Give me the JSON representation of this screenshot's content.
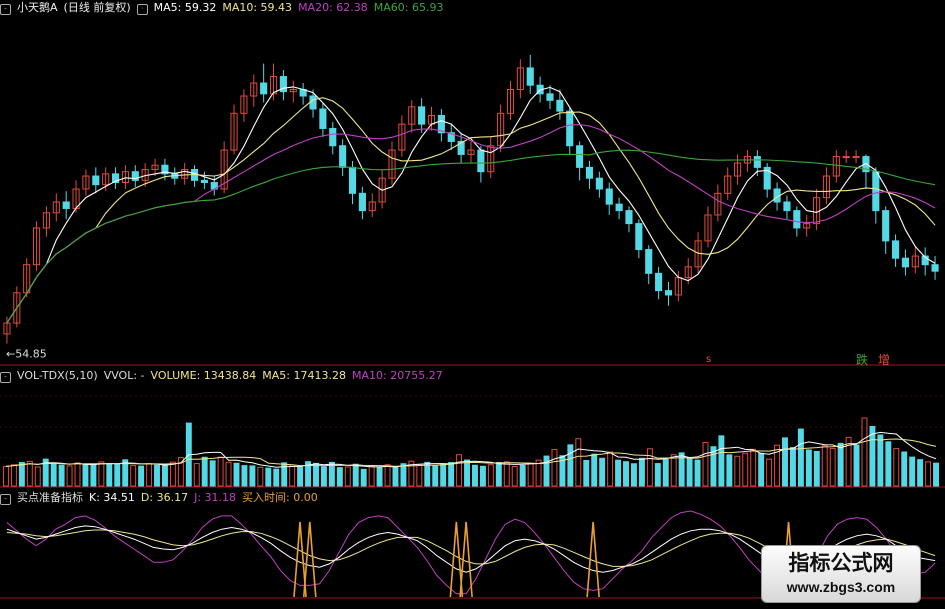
{
  "header_main": {
    "stock": "小天鹅A",
    "period": "(日线 前复权)",
    "ma5": "MA5: 59.32",
    "ma10": "MA10: 59.43",
    "ma20": "MA20: 62.38",
    "ma60": "MA60: 65.93"
  },
  "header_vol": {
    "name": "VOL-TDX(5,10)",
    "vvol": "VVOL: -",
    "volume": "VOLUME: 13438.84",
    "ma5": "MA5: 17413.28",
    "ma10": "MA10: 20755.27"
  },
  "header_kdj": {
    "name": "买点准备指标",
    "k": "K: 34.51",
    "d": "D: 36.17",
    "j": "J: 31.18",
    "buy": "买入时间: 0.00"
  },
  "annotations": {
    "low_price": "54.85",
    "marker_up": "增",
    "marker_down": "跌",
    "marker_left": "s"
  },
  "watermark": {
    "title": "指标公式网",
    "url": "www.zbgs3.com"
  },
  "colors": {
    "up": "#e24b3b",
    "down": "#54d8e6",
    "ma5": "#ffffff",
    "ma10": "#f0e68c",
    "ma20": "#c040c0",
    "ma60": "#3aa63a",
    "vol_ma5": "#ffffff",
    "vol_ma10": "#f0e68c",
    "kdj_k": "#ffffff",
    "kdj_d": "#f0e68c",
    "kdj_j": "#c040c0",
    "buy_spike": "#e8a030"
  },
  "chart_data": {
    "type": "candlestick",
    "price_ylim": [
      54,
      70
    ],
    "candles": [
      [
        55.3,
        55.8,
        54.85,
        56.1
      ],
      [
        55.8,
        57.2,
        55.6,
        57.5
      ],
      [
        57.2,
        58.5,
        57.0,
        58.8
      ],
      [
        58.5,
        60.2,
        58.2,
        60.5
      ],
      [
        60.2,
        60.9,
        59.8,
        61.2
      ],
      [
        60.9,
        61.4,
        60.5,
        61.8
      ],
      [
        61.4,
        61.1,
        60.6,
        61.9
      ],
      [
        61.1,
        62.0,
        60.9,
        62.4
      ],
      [
        62.0,
        62.6,
        61.7,
        62.9
      ],
      [
        62.6,
        62.2,
        61.8,
        63.0
      ],
      [
        62.2,
        62.7,
        61.9,
        63.0
      ],
      [
        62.7,
        62.3,
        62.0,
        63.0
      ],
      [
        62.3,
        62.8,
        62.0,
        63.1
      ],
      [
        62.8,
        62.4,
        62.1,
        63.1
      ],
      [
        62.4,
        62.9,
        62.1,
        63.2
      ],
      [
        62.9,
        63.1,
        62.6,
        63.4
      ],
      [
        63.1,
        62.7,
        62.4,
        63.4
      ],
      [
        62.7,
        62.5,
        62.2,
        63.0
      ],
      [
        62.5,
        62.9,
        62.2,
        63.2
      ],
      [
        62.9,
        62.4,
        62.1,
        63.1
      ],
      [
        62.4,
        62.3,
        62.0,
        62.8
      ],
      [
        62.3,
        62.0,
        61.7,
        62.6
      ],
      [
        62.0,
        63.8,
        61.8,
        64.2
      ],
      [
        63.8,
        65.5,
        63.6,
        65.9
      ],
      [
        65.5,
        66.3,
        65.1,
        66.6
      ],
      [
        66.3,
        66.9,
        65.8,
        67.3
      ],
      [
        66.9,
        66.4,
        66.0,
        67.8
      ],
      [
        66.4,
        67.2,
        66.1,
        67.8
      ],
      [
        67.2,
        66.5,
        66.1,
        67.5
      ],
      [
        66.5,
        66.6,
        66.0,
        67.0
      ],
      [
        66.6,
        66.3,
        65.9,
        66.9
      ],
      [
        66.3,
        65.7,
        65.3,
        66.6
      ],
      [
        65.7,
        64.8,
        64.4,
        66.0
      ],
      [
        64.8,
        64.0,
        63.6,
        65.1
      ],
      [
        64.0,
        63.0,
        62.6,
        64.3
      ],
      [
        63.0,
        61.8,
        61.3,
        63.3
      ],
      [
        61.8,
        61.0,
        60.6,
        62.1
      ],
      [
        61.0,
        61.4,
        60.7,
        61.8
      ],
      [
        61.4,
        62.5,
        61.1,
        62.9
      ],
      [
        62.5,
        63.8,
        62.2,
        64.2
      ],
      [
        63.8,
        65.0,
        63.5,
        65.4
      ],
      [
        65.0,
        65.8,
        64.6,
        66.1
      ],
      [
        65.8,
        65.0,
        64.6,
        66.2
      ],
      [
        65.0,
        65.4,
        64.7,
        65.8
      ],
      [
        65.4,
        64.6,
        64.2,
        65.7
      ],
      [
        64.6,
        64.2,
        63.8,
        65.0
      ],
      [
        64.2,
        63.6,
        63.2,
        64.6
      ],
      [
        63.6,
        63.8,
        63.2,
        64.2
      ],
      [
        63.8,
        62.8,
        62.3,
        64.0
      ],
      [
        62.8,
        64.0,
        62.5,
        64.4
      ],
      [
        64.0,
        65.5,
        63.7,
        65.9
      ],
      [
        65.5,
        66.6,
        65.2,
        67.0
      ],
      [
        66.6,
        67.6,
        66.2,
        68.0
      ],
      [
        67.6,
        66.8,
        66.4,
        68.2
      ],
      [
        66.8,
        66.4,
        66.0,
        67.2
      ],
      [
        66.4,
        66.1,
        65.7,
        66.8
      ],
      [
        66.1,
        65.6,
        65.2,
        66.6
      ],
      [
        65.6,
        64.0,
        63.6,
        65.8
      ],
      [
        64.0,
        63.0,
        62.4,
        64.2
      ],
      [
        63.0,
        62.5,
        62.0,
        63.3
      ],
      [
        62.5,
        62.0,
        61.6,
        62.8
      ],
      [
        62.0,
        61.3,
        60.8,
        62.3
      ],
      [
        61.3,
        61.0,
        60.6,
        61.6
      ],
      [
        61.0,
        60.4,
        60.0,
        61.2
      ],
      [
        60.4,
        59.2,
        58.8,
        60.6
      ],
      [
        59.2,
        58.1,
        57.6,
        59.4
      ],
      [
        58.1,
        57.3,
        56.9,
        58.4
      ],
      [
        57.3,
        57.1,
        56.6,
        57.7
      ],
      [
        57.1,
        57.9,
        56.8,
        58.2
      ],
      [
        57.9,
        58.4,
        57.6,
        58.8
      ],
      [
        58.4,
        59.6,
        58.1,
        60.0
      ],
      [
        59.6,
        60.8,
        59.3,
        61.2
      ],
      [
        60.8,
        61.8,
        60.5,
        62.2
      ],
      [
        61.8,
        62.6,
        61.5,
        63.0
      ],
      [
        62.6,
        63.2,
        62.2,
        63.6
      ],
      [
        63.2,
        63.5,
        62.8,
        63.8
      ],
      [
        63.5,
        63.0,
        62.6,
        63.8
      ],
      [
        63.0,
        62.0,
        61.6,
        63.2
      ],
      [
        62.0,
        61.4,
        61.0,
        62.3
      ],
      [
        61.4,
        61.0,
        60.6,
        61.7
      ],
      [
        61.0,
        60.2,
        59.8,
        61.2
      ],
      [
        60.2,
        60.4,
        59.8,
        60.8
      ],
      [
        60.4,
        61.6,
        60.1,
        62.0
      ],
      [
        61.6,
        62.6,
        61.3,
        63.0
      ],
      [
        62.6,
        63.5,
        62.3,
        63.8
      ],
      [
        63.5,
        63.5,
        63.2,
        63.8
      ],
      [
        63.5,
        63.5,
        63.2,
        63.8
      ],
      [
        63.5,
        62.8,
        62.0,
        63.6
      ],
      [
        62.8,
        61.0,
        60.4,
        63.0
      ],
      [
        61.0,
        59.6,
        59.0,
        61.2
      ],
      [
        59.6,
        58.8,
        58.4,
        59.9
      ],
      [
        58.8,
        58.4,
        58.0,
        59.2
      ],
      [
        58.4,
        58.9,
        58.1,
        59.3
      ],
      [
        58.9,
        58.5,
        58.0,
        59.3
      ],
      [
        58.5,
        58.2,
        57.8,
        58.9
      ]
    ],
    "volume_ylim": [
      0,
      60000
    ],
    "volume": [
      11500,
      12500,
      13800,
      14500,
      11200,
      15800,
      13200,
      12200,
      11800,
      13600,
      12800,
      12500,
      14200,
      13000,
      12900,
      15400,
      12000,
      11700,
      13100,
      12200,
      12400,
      14000,
      16800,
      37000,
      13200,
      16900,
      14800,
      17000,
      14000,
      13400,
      12000,
      11800,
      11000,
      10500,
      9900,
      13600,
      12300,
      11500,
      14300,
      13300,
      11300,
      13900,
      10800,
      11200,
      12800,
      9800,
      11500,
      10900,
      12500,
      11300,
      13100,
      14600,
      12700,
      13900,
      11700,
      12900,
      13800,
      18400,
      15300,
      12200,
      11600,
      12500,
      13800,
      14200,
      11500,
      12100,
      13300,
      15200,
      17600,
      21500,
      17800,
      24200,
      27800,
      15000,
      18700,
      16300,
      20000,
      15200,
      14300,
      13100,
      16300,
      21900,
      13200,
      15700,
      18400,
      19500,
      16800,
      15200,
      25600,
      23100,
      29500,
      18300,
      17500,
      19300,
      21600,
      19200,
      15800,
      24000,
      28300,
      22600,
      33500,
      21200,
      20300,
      23700,
      22100,
      25100,
      28600,
      24100,
      40000,
      35000,
      30000,
      26000,
      22000,
      20000,
      17000,
      15500,
      14200,
      13438
    ],
    "kdj_ylim": [
      -10,
      100
    ],
    "kdj_k": [
      72,
      68,
      64,
      60,
      62,
      66,
      70,
      74,
      76,
      75,
      72,
      68,
      64,
      60,
      55,
      50,
      48,
      47,
      50,
      55,
      62,
      68,
      72,
      74,
      72,
      68,
      62,
      55,
      46,
      38,
      32,
      28,
      26,
      30,
      38,
      48,
      56,
      62,
      66,
      68,
      66,
      62,
      58,
      50,
      40,
      32,
      24,
      20,
      24,
      32,
      42,
      52,
      58,
      60,
      58,
      54,
      48,
      40,
      32,
      26,
      22,
      20,
      22,
      26,
      30,
      36,
      44,
      52,
      60,
      66,
      70,
      72,
      72,
      70,
      66,
      60,
      52,
      44,
      36,
      30,
      26,
      24,
      28,
      36,
      46,
      54,
      60,
      64,
      66,
      64,
      60,
      52,
      44,
      38,
      36,
      34
    ],
    "kdj_d": [
      68,
      67,
      66,
      64,
      63,
      64,
      66,
      68,
      70,
      71,
      71,
      70,
      68,
      66,
      63,
      59,
      56,
      53,
      52,
      53,
      56,
      60,
      64,
      67,
      69,
      69,
      67,
      63,
      58,
      52,
      46,
      40,
      36,
      34,
      35,
      39,
      44,
      50,
      55,
      59,
      62,
      62,
      62,
      58,
      52,
      46,
      39,
      33,
      30,
      30,
      33,
      39,
      45,
      50,
      53,
      54,
      53,
      49,
      44,
      39,
      34,
      30,
      27,
      27,
      28,
      31,
      35,
      41,
      47,
      53,
      58,
      63,
      66,
      67,
      67,
      65,
      61,
      55,
      49,
      43,
      38,
      34,
      32,
      33,
      37,
      42,
      48,
      53,
      57,
      59,
      60,
      57,
      53,
      48,
      44,
      40
    ],
    "kdj_j": [
      80,
      70,
      60,
      52,
      60,
      72,
      78,
      86,
      88,
      83,
      74,
      64,
      56,
      48,
      40,
      32,
      32,
      35,
      46,
      59,
      74,
      84,
      88,
      88,
      78,
      66,
      52,
      39,
      22,
      10,
      4,
      4,
      6,
      22,
      44,
      66,
      80,
      86,
      88,
      86,
      74,
      62,
      50,
      34,
      16,
      4,
      -6,
      -6,
      12,
      36,
      60,
      78,
      84,
      80,
      68,
      54,
      38,
      22,
      8,
      0,
      -2,
      0,
      12,
      24,
      34,
      46,
      62,
      74,
      86,
      92,
      94,
      90,
      84,
      76,
      64,
      50,
      34,
      22,
      10,
      4,
      2,
      4,
      20,
      42,
      64,
      78,
      84,
      86,
      84,
      74,
      60,
      42,
      26,
      18,
      20,
      31
    ]
  }
}
